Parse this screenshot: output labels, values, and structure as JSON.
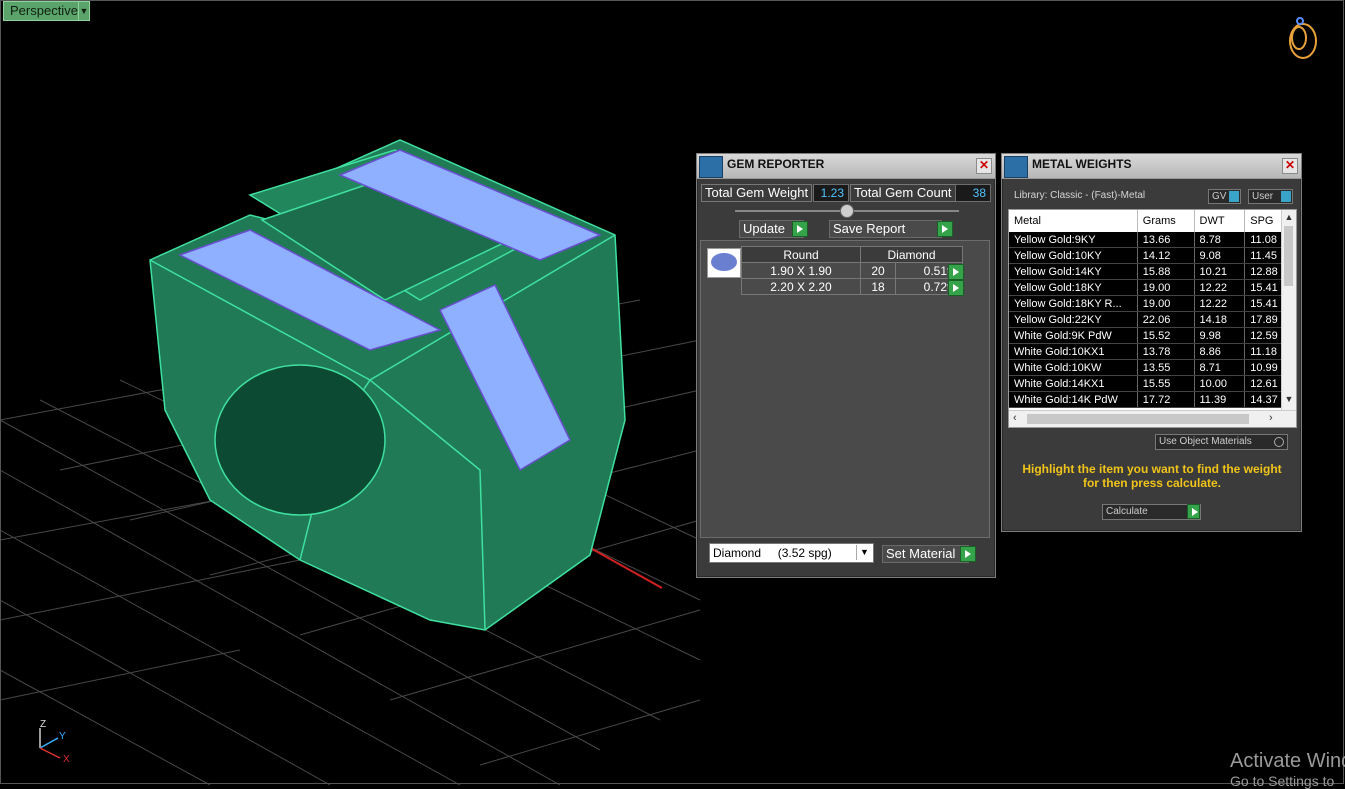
{
  "viewport": {
    "label": "Perspective",
    "axes": {
      "z": "Z",
      "y": "Y",
      "x": "X"
    }
  },
  "gem_reporter": {
    "title": "GEM REPORTER",
    "total_weight_label": "Total Gem Weight",
    "total_weight_value": "1.23",
    "total_count_label": "Total Gem Count",
    "total_count_value": "38",
    "update_label": "Update",
    "save_report_label": "Save Report",
    "table": {
      "headers": [
        "Round",
        "Diamond"
      ],
      "rows": [
        {
          "size": "1.90 X 1.90",
          "count": "20",
          "tw": "0.51tw"
        },
        {
          "size": "2.20 X 2.20",
          "count": "18",
          "tw": "0.72tw"
        }
      ]
    },
    "material_select": "Diamond     (3.52 spg)",
    "set_material_label": "Set Material"
  },
  "metal_weights": {
    "title": "METAL WEIGHTS",
    "library": "Library: Classic - (Fast)-Metal",
    "gv_label": "GV",
    "user_label": "User",
    "columns": [
      "Metal",
      "Grams",
      "DWT",
      "SPG"
    ],
    "rows": [
      [
        "Yellow Gold:9KY",
        "13.66",
        "8.78",
        "11.08"
      ],
      [
        "Yellow Gold:10KY",
        "14.12",
        "9.08",
        "11.45"
      ],
      [
        "Yellow Gold:14KY",
        "15.88",
        "10.21",
        "12.88"
      ],
      [
        "Yellow Gold:18KY",
        "19.00",
        "12.22",
        "15.41"
      ],
      [
        "Yellow Gold:18KY R...",
        "19.00",
        "12.22",
        "15.41"
      ],
      [
        "Yellow Gold:22KY",
        "22.06",
        "14.18",
        "17.89"
      ],
      [
        "White Gold:9K PdW",
        "15.52",
        "9.98",
        "12.59"
      ],
      [
        "White Gold:10KX1",
        "13.78",
        "8.86",
        "11.18"
      ],
      [
        "White Gold:10KW",
        "13.55",
        "8.71",
        "10.99"
      ],
      [
        "White Gold:14KX1",
        "15.55",
        "10.00",
        "12.61"
      ],
      [
        "White Gold:14K PdW",
        "17.72",
        "11.39",
        "14.37"
      ]
    ],
    "use_object_materials": "Use Object Materials",
    "hint": "Highlight the item you want to find the weight for then press calculate.",
    "calculate_label": "Calculate"
  },
  "watermark": {
    "line1": "Activate Wind",
    "line2": "Go to Settings to"
  }
}
